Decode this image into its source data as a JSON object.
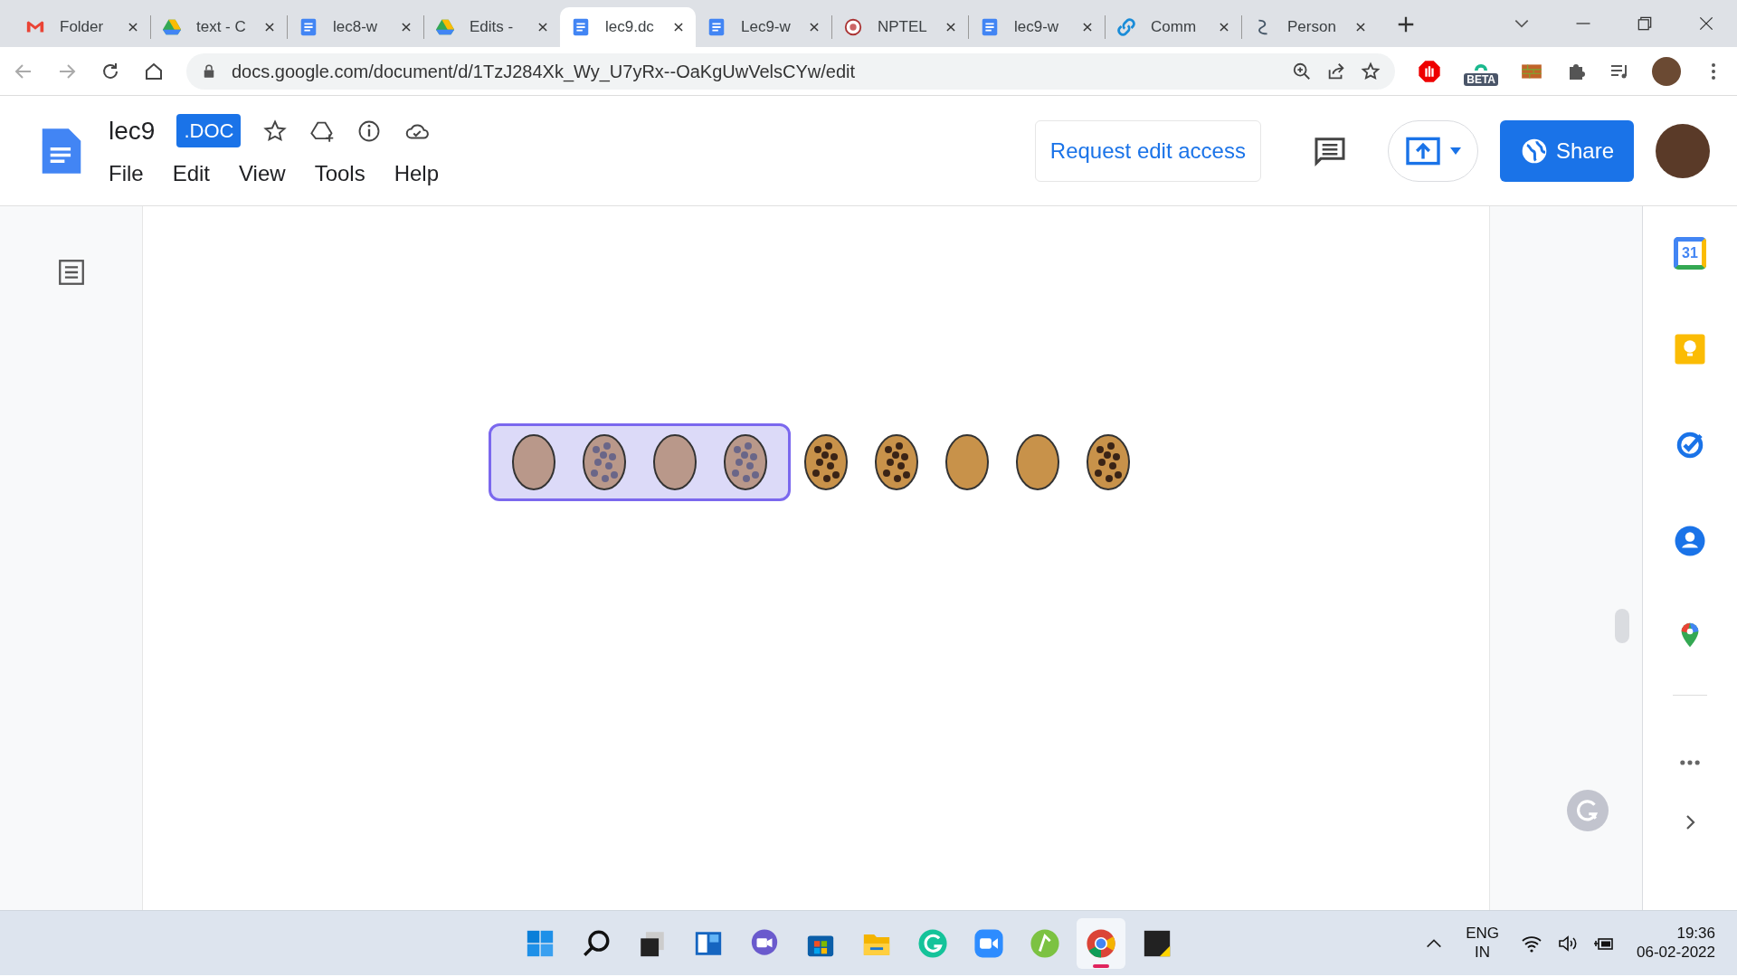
{
  "tabs": [
    {
      "kind": "gmail",
      "label": "Folder",
      "selected": false
    },
    {
      "kind": "drive",
      "label": "text - C",
      "selected": false
    },
    {
      "kind": "docs",
      "label": "lec8-w",
      "selected": false
    },
    {
      "kind": "drive",
      "label": "Edits -",
      "selected": false
    },
    {
      "kind": "docs",
      "label": "lec9.dc",
      "selected": true
    },
    {
      "kind": "docs",
      "label": "Lec9-w",
      "selected": false
    },
    {
      "kind": "nptel",
      "label": "NPTEL",
      "selected": false
    },
    {
      "kind": "docs",
      "label": "lec9-w",
      "selected": false
    },
    {
      "kind": "link",
      "label": "Comm",
      "selected": false
    },
    {
      "kind": "person",
      "label": "Person",
      "selected": false
    }
  ],
  "address": "docs.google.com/document/d/1TzJ284Xk_Wy_U7yRx--OaKgUwVelsCYw/edit",
  "extension_badge": "BETA",
  "doc": {
    "title": "lec9",
    "format_badge": ".DOC",
    "menu": [
      "File",
      "Edit",
      "View",
      "Tools",
      "Help"
    ],
    "request_button": "Request edit access",
    "share_button": "Share"
  },
  "cookies": [
    {
      "kind": "plain",
      "selected": true
    },
    {
      "kind": "chip",
      "selected": true
    },
    {
      "kind": "plain",
      "selected": true
    },
    {
      "kind": "chip",
      "selected": true
    },
    {
      "kind": "chip",
      "selected": false
    },
    {
      "kind": "chip",
      "selected": false
    },
    {
      "kind": "plain",
      "selected": false
    },
    {
      "kind": "plain",
      "selected": false
    },
    {
      "kind": "chip",
      "selected": false
    }
  ],
  "side_panel": {
    "calendar_day": "31"
  },
  "taskbar": {
    "apps": [
      {
        "kind": "start",
        "active": false
      },
      {
        "kind": "search",
        "active": false
      },
      {
        "kind": "taskview",
        "active": false
      },
      {
        "kind": "widgets",
        "active": false
      },
      {
        "kind": "chat",
        "active": false
      },
      {
        "kind": "store",
        "active": false
      },
      {
        "kind": "explorer",
        "active": false
      },
      {
        "kind": "grammarly",
        "active": false
      },
      {
        "kind": "zoom",
        "active": false
      },
      {
        "kind": "green",
        "active": false
      },
      {
        "kind": "chrome",
        "active": true
      },
      {
        "kind": "notes",
        "active": false
      }
    ],
    "language": "ENG",
    "region": "IN",
    "time": "19:36",
    "date": "06-02-2022"
  }
}
